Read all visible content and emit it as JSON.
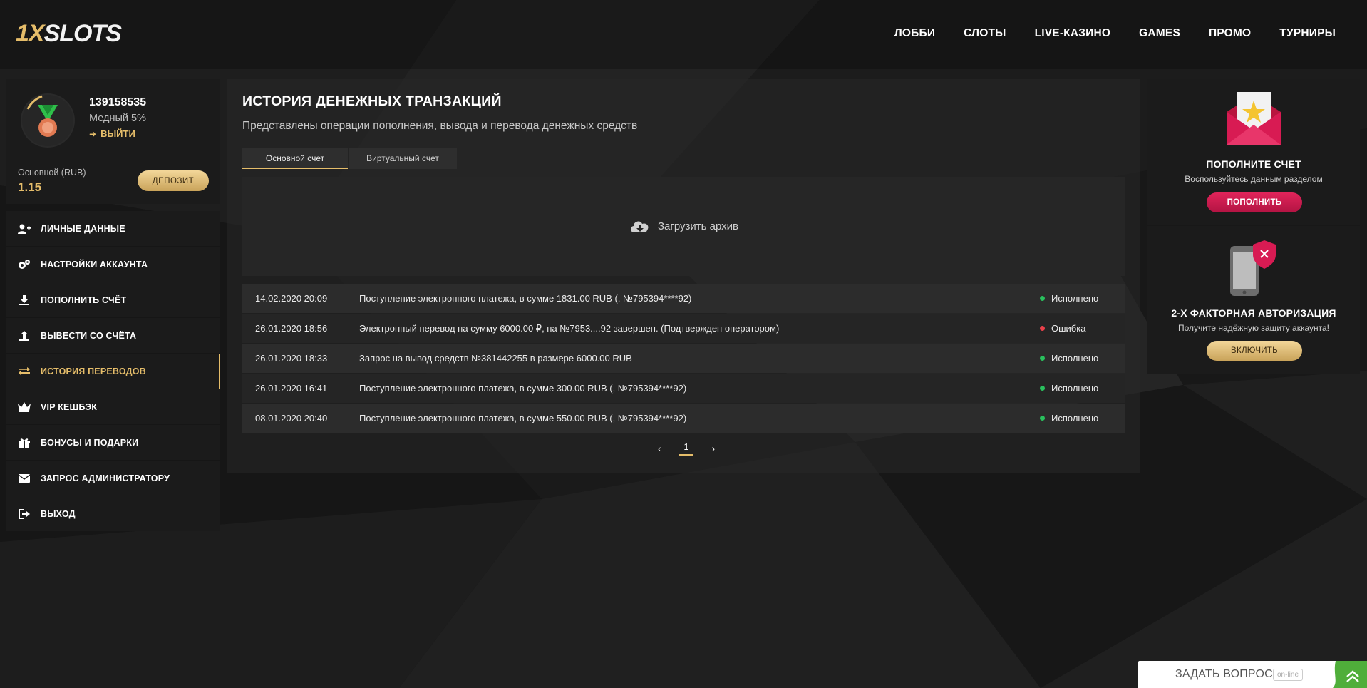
{
  "header": {
    "logo": {
      "part1": "1X",
      "part2": "SLOTS"
    },
    "nav": [
      "ЛОББИ",
      "СЛОТЫ",
      "LIVE-КАЗИНО",
      "GAMES",
      "ПРОМО",
      "ТУРНИРЫ"
    ]
  },
  "profile": {
    "user_id": "139158535",
    "level": "Медный 5%",
    "exit_label": "ВЫЙТИ",
    "balance_label": "Основной (RUB)",
    "balance_value": "1.15",
    "deposit_button": "ДЕПОЗИТ"
  },
  "menu": {
    "items": [
      {
        "label": "ЛИЧНЫЕ ДАННЫЕ",
        "icon": "user-add-icon"
      },
      {
        "label": "НАСТРОЙКИ АККАУНТА",
        "icon": "gears-icon"
      },
      {
        "label": "ПОПОЛНИТЬ СЧЁТ",
        "icon": "download-icon"
      },
      {
        "label": "ВЫВЕСТИ СО СЧЁТА",
        "icon": "upload-icon"
      },
      {
        "label": "ИСТОРИЯ ПЕРЕВОДОВ",
        "icon": "transfer-arrows-icon",
        "active": true
      },
      {
        "label": "VIP КЕШБЭК",
        "icon": "crown-icon"
      },
      {
        "label": "БОНУСЫ И ПОДАРКИ",
        "icon": "gift-icon"
      },
      {
        "label": "ЗАПРОС АДМИНИСТРАТОРУ",
        "icon": "envelope-icon"
      },
      {
        "label": "ВЫХОД",
        "icon": "sign-out-icon"
      }
    ]
  },
  "main": {
    "title": "ИСТОРИЯ ДЕНЕЖНЫХ ТРАНЗАКЦИЙ",
    "subtitle": "Представлены операции пополнения, вывода и перевода денежных средств",
    "tabs": [
      {
        "label": "Основной счет",
        "active": true
      },
      {
        "label": "Виртуальный счет",
        "active": false
      }
    ],
    "archive_label": "Загрузить архив",
    "transactions": [
      {
        "date": "14.02.2020 20:09",
        "description": "Поступление электронного платежа, в сумме 1831.00 RUB (, №795394****92)",
        "status": "Исполнено",
        "status_type": "ok"
      },
      {
        "date": "26.01.2020 18:56",
        "description": "Электронный перевод на сумму 6000.00 ₽, на №7953....92 завершен. (Подтвержден оператором)",
        "status": "Ошибка",
        "status_type": "err"
      },
      {
        "date": "26.01.2020 18:33",
        "description": "Запрос на вывод средств №381442255 в размере 6000.00 RUB",
        "status": "Исполнено",
        "status_type": "ok"
      },
      {
        "date": "26.01.2020 16:41",
        "description": "Поступление электронного платежа, в сумме 300.00 RUB (, №795394****92)",
        "status": "Исполнено",
        "status_type": "ok"
      },
      {
        "date": "08.01.2020 20:40",
        "description": "Поступление электронного платежа, в сумме 550.00 RUB (, №795394****92)",
        "status": "Исполнено",
        "status_type": "ok"
      }
    ],
    "pagination": {
      "prev": "‹",
      "current": "1",
      "next": "›"
    }
  },
  "promo1": {
    "title": "ПОПОЛНИТЕ СЧЕТ",
    "text": "Воспользуйтесь данным разделом",
    "button": "ПОПОЛНИТЬ"
  },
  "promo2": {
    "title": "2-Х ФАКТОРНАЯ АВТОРИЗАЦИЯ",
    "text": "Получите надёжную защиту аккаунта!",
    "button": "ВКЛЮЧИТЬ"
  },
  "chat": {
    "label": "ЗАДАТЬ ВОПРОС",
    "badge": "on-line"
  },
  "colors": {
    "accent_gold": "#e5bd6a",
    "accent_pink": "#d81b53",
    "ok_green": "#29c05d",
    "error_red": "#e9404a"
  }
}
